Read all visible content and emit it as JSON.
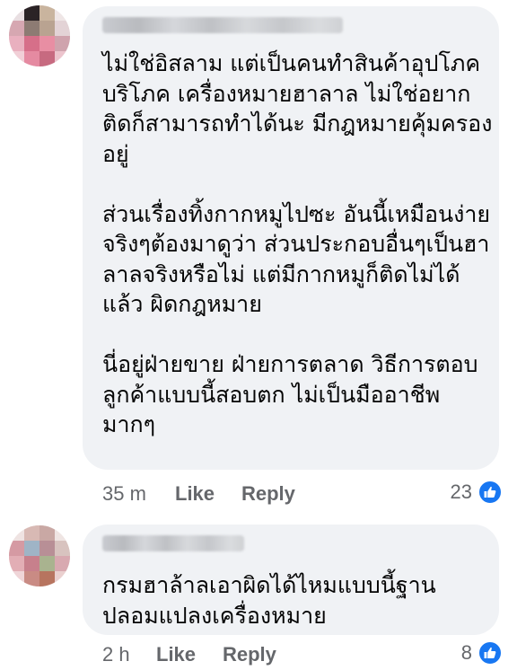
{
  "comments": [
    {
      "text": "ไม่ใช่อิสลาม แต่เป็นคนทำสินค้าอุปโภค\nบริโภค เครื่องหมายฮาลาล ไม่ใช่อยาก\nติดก็สามารถทำได้นะ มีกฎหมายคุ้มครอง\nอยู่\n\nส่วนเรื่องทิ้งกากหมูไปซะ อันนี้เหมือนง่าย\nจริงๆต้องมาดูว่า ส่วนประกอบอื่นๆเป็นฮา\nลาลจริงหรือไม่ แต่มีกากหมูก็ติดไม่ได้\nแล้ว ผิดกฎหมาย\n\nนี่อยู่ฝ่ายขาย ฝ่ายการตลาด วิธีการตอบ\nลูกค้าแบบนี้สอบตก ไม่เป็นมืออาชีพ\nมากๆ",
      "time": "35 m",
      "like_label": "Like",
      "reply_label": "Reply",
      "reaction_count": "23",
      "reaction_icon": "like-thumbs-up-icon"
    },
    {
      "text": "กรมฮาล้าลเอาผิดได้ไหมแบบนี้ฐาน\nปลอมแปลงเครื่องหมาย",
      "time": "2 h",
      "like_label": "Like",
      "reply_label": "Reply",
      "reaction_count": "8",
      "reaction_icon": "like-thumbs-up-icon"
    }
  ],
  "colors": {
    "bubble": "#f0f2f5",
    "text": "#050505",
    "meta": "#65676b",
    "like_blue": "#1877f2"
  }
}
